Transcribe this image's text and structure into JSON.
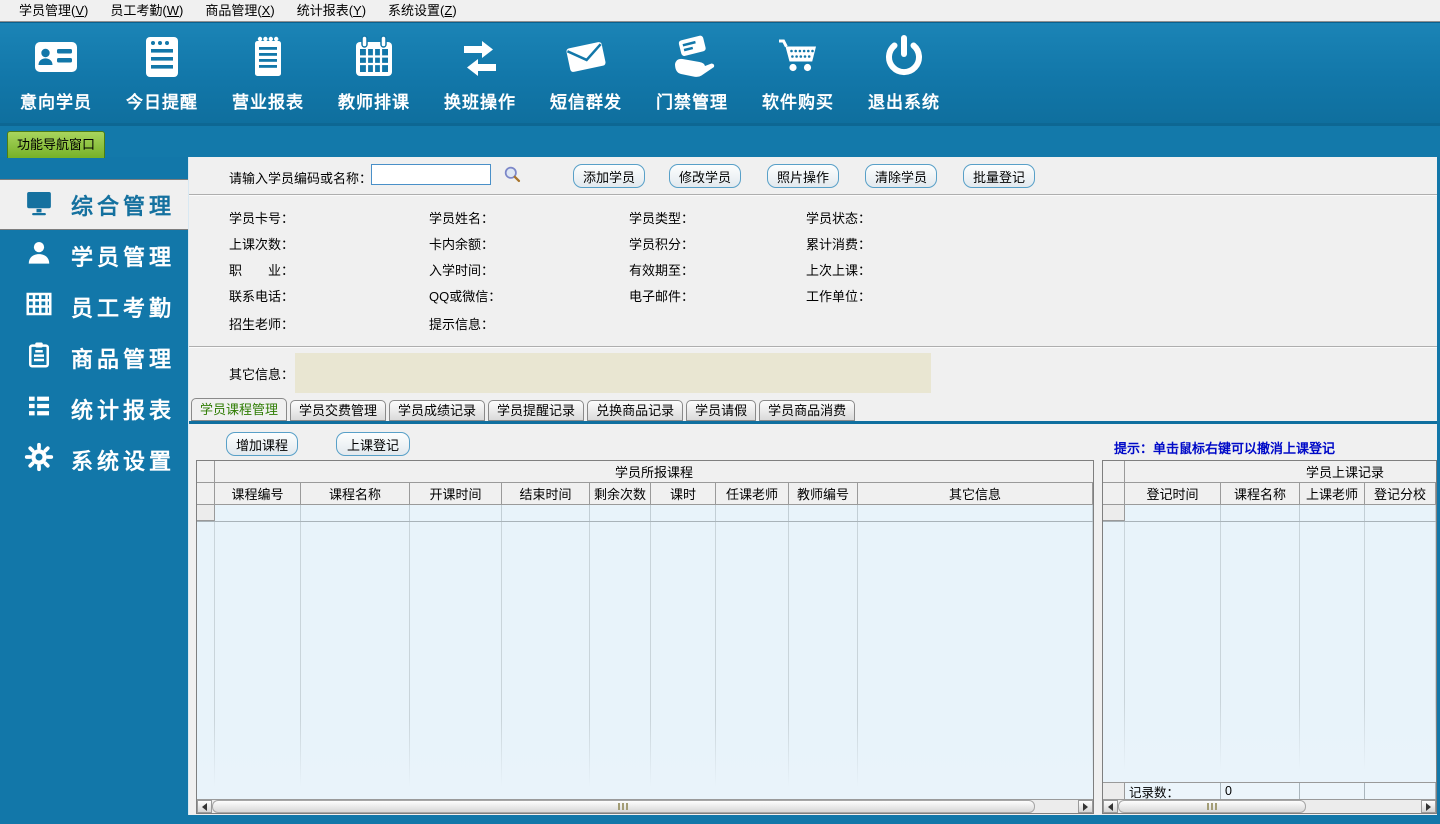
{
  "menubar": {
    "items": [
      {
        "text": "学员管理",
        "mnemonic": "V"
      },
      {
        "text": "员工考勤",
        "mnemonic": "W"
      },
      {
        "text": "商品管理",
        "mnemonic": "X"
      },
      {
        "text": "统计报表",
        "mnemonic": "Y"
      },
      {
        "text": "系统设置",
        "mnemonic": "Z"
      }
    ]
  },
  "toolbar": {
    "items": [
      {
        "label": "意向学员",
        "icon": "id-card"
      },
      {
        "label": "今日提醒",
        "icon": "reminder-window"
      },
      {
        "label": "营业报表",
        "icon": "notepad"
      },
      {
        "label": "教师排课",
        "icon": "calendar"
      },
      {
        "label": "换班操作",
        "icon": "swap-arrows"
      },
      {
        "label": "短信群发",
        "icon": "envelope"
      },
      {
        "label": "门禁管理",
        "icon": "hand-card"
      },
      {
        "label": "软件购买",
        "icon": "shopping-cart"
      },
      {
        "label": "退出系统",
        "icon": "power"
      }
    ]
  },
  "nav_strip": {
    "tab_label": "功能导航窗口"
  },
  "sidebar": {
    "items": [
      {
        "label": "综合管理",
        "icon": "monitor",
        "active": true
      },
      {
        "label": "学员管理",
        "icon": "user",
        "active": false
      },
      {
        "label": "员工考勤",
        "icon": "attendance-grid",
        "active": false
      },
      {
        "label": "商品管理",
        "icon": "clipboard",
        "active": false
      },
      {
        "label": "统计报表",
        "icon": "report-list",
        "active": false
      },
      {
        "label": "系统设置",
        "icon": "gear",
        "active": false
      }
    ]
  },
  "search": {
    "label": "请输入学员编码或名称：",
    "value": "",
    "buttons": [
      "添加学员",
      "修改学员",
      "照片操作",
      "清除学员",
      "批量登记"
    ]
  },
  "student_form": {
    "rows": [
      [
        "学员卡号：",
        "学员姓名：",
        "学员类型：",
        "学员状态："
      ],
      [
        "上课次数：",
        "卡内余额：",
        "学员积分：",
        "累计消费："
      ],
      [
        "职　　业：",
        "入学时间：",
        "有效期至：",
        "上次上课："
      ],
      [
        "联系电话：",
        "QQ或微信：",
        "电子邮件：",
        "工作单位："
      ],
      [
        "招生老师：",
        "提示信息："
      ]
    ],
    "other_info_label": "其它信息：",
    "other_info_value": ""
  },
  "tabs": {
    "items": [
      "学员课程管理",
      "学员交费管理",
      "学员成绩记录",
      "学员提醒记录",
      "兑换商品记录",
      "学员请假",
      "学员商品消费"
    ],
    "active_index": 0
  },
  "course_panel": {
    "buttons": [
      "增加课程",
      "上课登记"
    ],
    "group_header": "学员所报课程",
    "columns": [
      "课程编号",
      "课程名称",
      "开课时间",
      "结束时间",
      "剩余次数",
      "课时",
      "任课老师",
      "教师编号",
      "其它信息"
    ],
    "rows": []
  },
  "record_panel": {
    "hint": "提示：单击鼠标右键可以撤消上课登记",
    "group_header": "学员上课记录",
    "columns": [
      "登记时间",
      "课程名称",
      "上课老师",
      "登记分校"
    ],
    "rows": [],
    "footer": {
      "label": "记录数：",
      "value": "0"
    }
  },
  "colors": {
    "toolbar_blue": "#1277a9",
    "accent_green": "#76b128",
    "grid_body_blue": "#e8f3fa",
    "hint_blue": "#000ac8",
    "info_box_beige": "#e9e6d2",
    "active_tab_green": "#2f7d04",
    "content_gray": "#f0f0f0"
  }
}
